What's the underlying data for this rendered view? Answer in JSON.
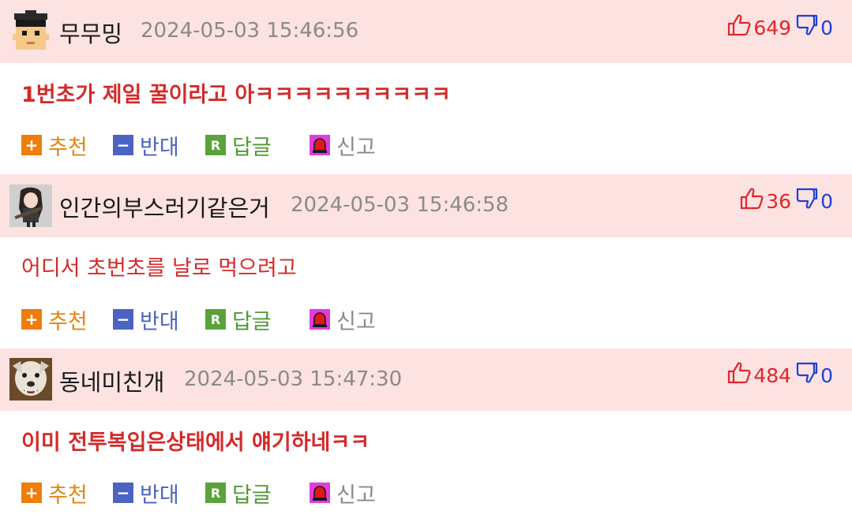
{
  "comments": [
    {
      "nickname": "무무밍",
      "timestamp": "2024-05-03 15:46:56",
      "upvotes": "649",
      "downvotes": "0",
      "body": "1번초가 제일 꿀이라고 아ㅋㅋㅋㅋㅋㅋㅋㅋㅋㅋ",
      "body_bold": true,
      "avatar_icon": "pixel-face-avatar"
    },
    {
      "nickname": "인간의부스러기같은거",
      "timestamp": "2024-05-03 15:46:58",
      "upvotes": "36",
      "downvotes": "0",
      "body": "어디서 초번초를 날로 먹으려고",
      "body_bold": false,
      "avatar_icon": "anime-character-avatar"
    },
    {
      "nickname": "동네미친개",
      "timestamp": "2024-05-03 15:47:30",
      "upvotes": "484",
      "downvotes": "0",
      "body": "이미 전투복입은상태에서 얘기하네ㅋㅋ",
      "body_bold": true,
      "avatar_icon": "dog-photo-avatar"
    }
  ],
  "actions": {
    "recommend": "추천",
    "oppose": "반대",
    "reply": "답글",
    "report": "신고",
    "recommend_icon": "+",
    "oppose_icon": "−",
    "reply_icon": "R"
  },
  "colors": {
    "header_bg": "#fde2e2",
    "upvote": "#e0262a",
    "downvote": "#1f3fd8",
    "comment_text": "#d42a2a"
  }
}
